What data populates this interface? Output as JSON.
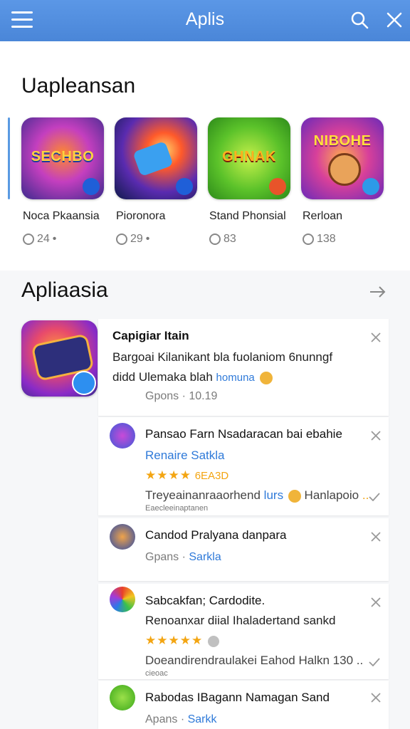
{
  "appbar": {
    "title": "Aplis"
  },
  "section1": {
    "title": "Uapleansan",
    "cards": [
      {
        "name": "Noca Pkaansia",
        "stat": "24",
        "art": "SECHBO"
      },
      {
        "name": "Pioronora",
        "stat": "29",
        "art": ""
      },
      {
        "name": "Stand Phonsial",
        "stat": "83",
        "art": "GHNAK"
      },
      {
        "name": "Rerloan",
        "stat": "138",
        "art": "NIBOHE"
      }
    ]
  },
  "section2": {
    "title": "Apliaasia",
    "notifications": [
      {
        "title": "Capigiar Itain",
        "line1": "Bargoai Kilanikant bla fuolaniom 6nunngf",
        "line2_text": "didd Ulemaka blah",
        "line2_link": "homuna",
        "meta": "Gpons · 10.19"
      },
      {
        "title": "Pansao Farn Nsadaracan bai ebahie",
        "link": "Renaire Satkla",
        "stars": "★★★★",
        "stars_text": "6EA3D",
        "line_a": "Treyeainanraaorhend",
        "line_a_link": "lurs",
        "line_a_tail": "Hanlapoio",
        "small": "Eaecleeinaptanen"
      },
      {
        "title": "Candod Pralyana danpara",
        "meta_a": "Gpans ·",
        "meta_link": "Sarkla"
      },
      {
        "title": "Sabcakfan; Cardodite.",
        "line": "Renoanxar diial Ihaladertand sankd",
        "stars": "★★★★★",
        "line_b": "Doeandirendraulakei Eahod Halkn 130 ..",
        "small": "cieoac"
      },
      {
        "title": "Rabodas IBagann Namagan Sand",
        "meta_a": "Apans ·",
        "meta_link": "Sarkk"
      }
    ]
  }
}
